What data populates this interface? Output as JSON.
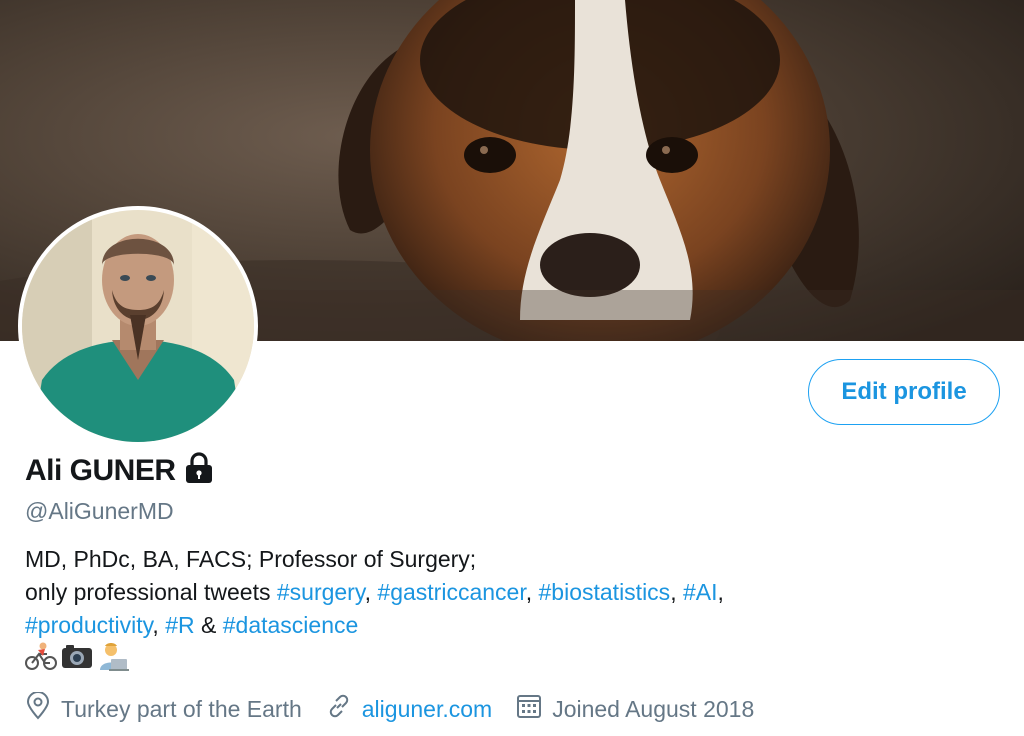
{
  "banner": {
    "description_icon": "dog-photo"
  },
  "profile": {
    "display_name": "Ali GUNER",
    "lock_icon": "lock-icon",
    "handle": "@AliGunerMD",
    "edit_button_label": "Edit profile",
    "bio": {
      "line1": "MD, PhDc, BA, FACS; Professor of Surgery;",
      "line2_text": "only professional tweets ",
      "tags": [
        "#surgery",
        "#gastriccancer",
        "#biostatistics",
        "#AI",
        "#productivity",
        "#R",
        "#datascience"
      ],
      "ampersand": "&",
      "comma": ","
    },
    "emojis": [
      "cyclist",
      "camera",
      "technologist"
    ],
    "location": "Turkey part of the Earth",
    "website": "aliguner.com",
    "joined": "Joined August 2018"
  },
  "colors": {
    "accent": "#1b95e0",
    "secondary_text": "#657786",
    "primary_text": "#14171a"
  }
}
